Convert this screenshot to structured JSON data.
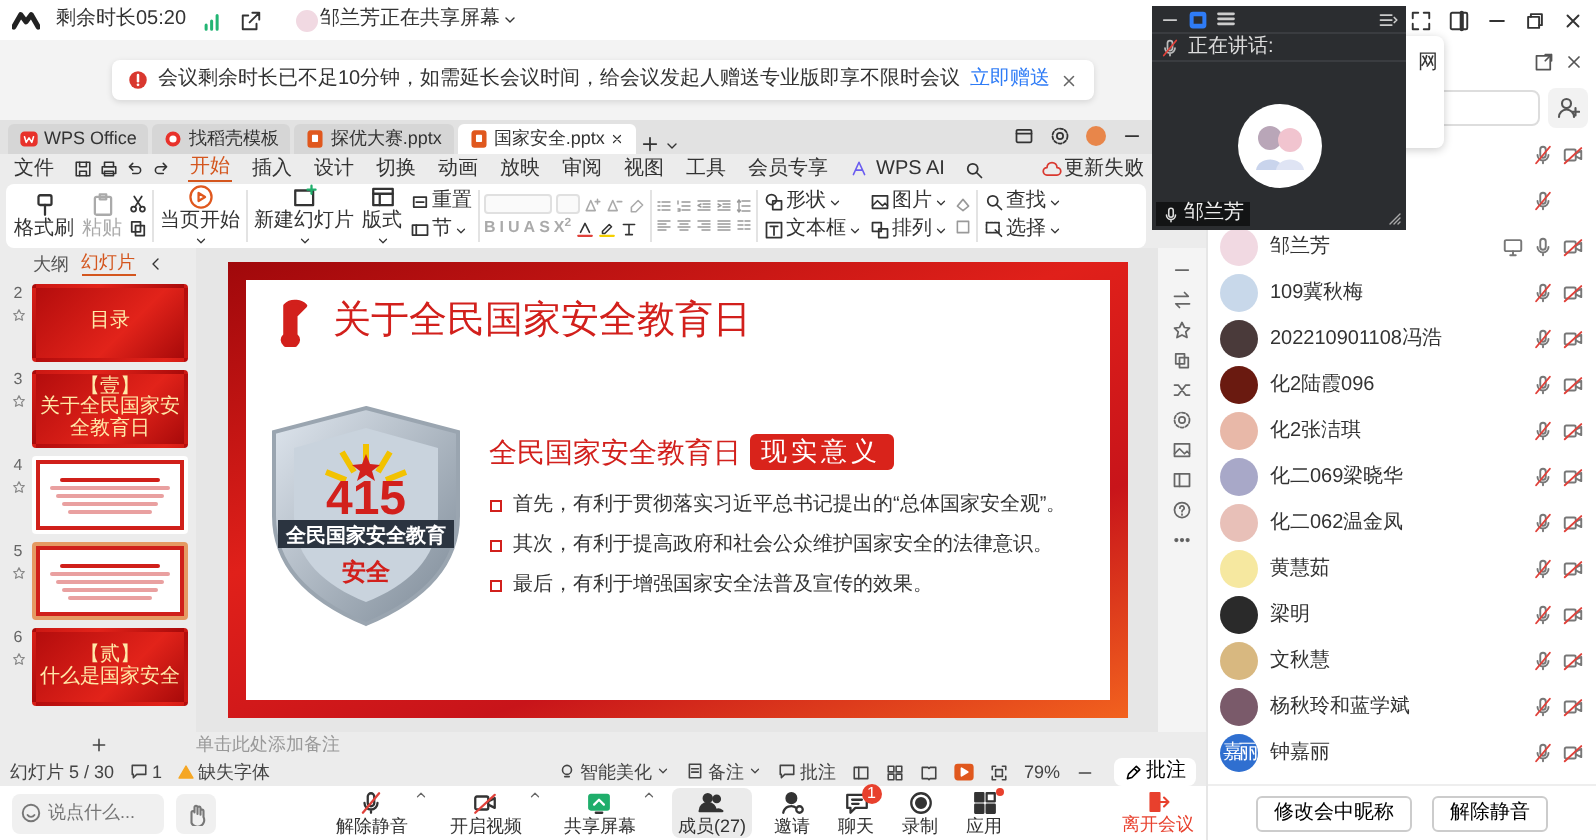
{
  "meeting_bar": {
    "remaining": "剩余时长05:20",
    "sharing": "邹兰芳正在共享屏幕"
  },
  "notice": {
    "text": "会议剩余时长已不足10分钟，如需延长会议时间，给会议发起人赠送专业版即享不限时会议",
    "link": "立即赠送"
  },
  "wps": {
    "tabs": [
      {
        "label": "WPS Office",
        "kind": "home",
        "selected": false
      },
      {
        "label": "找稻壳模板",
        "kind": "template",
        "selected": false
      },
      {
        "label": "探优大赛.pptx",
        "kind": "doc",
        "selected": false
      },
      {
        "label": "国家安全.pptx",
        "kind": "doc",
        "selected": true
      }
    ],
    "menu": [
      {
        "label": "文件",
        "selected": false
      },
      {
        "label": "开始",
        "selected": true
      },
      {
        "label": "插入",
        "selected": false
      },
      {
        "label": "设计",
        "selected": false
      },
      {
        "label": "切换",
        "selected": false
      },
      {
        "label": "动画",
        "selected": false
      },
      {
        "label": "放映",
        "selected": false
      },
      {
        "label": "审阅",
        "selected": false
      },
      {
        "label": "视图",
        "selected": false
      },
      {
        "label": "工具",
        "selected": false
      },
      {
        "label": "会员专享",
        "selected": false
      },
      {
        "label": "WPS AI",
        "selected": false
      }
    ],
    "update": "更新失败",
    "ribbon": {
      "format_painter": "格式刷",
      "paste": "粘贴",
      "start_here": "当页开始",
      "new_slide": "新建幻灯片",
      "layout": "版式",
      "reset": "重置",
      "section": "节",
      "font_buttons": [
        "B",
        "I",
        "U",
        "A",
        "S",
        "X$^{2}$"
      ],
      "shape": "形状",
      "picture": "图片",
      "textbox": "文本框",
      "arrange": "排列",
      "find": "查找",
      "select": "选择"
    },
    "panel_tabs": [
      {
        "label": "大纲",
        "selected": false
      },
      {
        "label": "幻灯片",
        "selected": true
      }
    ],
    "thumbnails": [
      {
        "number": "2",
        "kind": "title",
        "selected": false,
        "texts": [
          "目录"
        ]
      },
      {
        "number": "3",
        "kind": "title",
        "selected": false,
        "texts": [
          "【壹】",
          "关于全民国家安全教育日"
        ]
      },
      {
        "number": "4",
        "kind": "content",
        "selected": false
      },
      {
        "number": "5",
        "kind": "content",
        "selected": true
      },
      {
        "number": "6",
        "kind": "title",
        "selected": false,
        "texts": [
          "【贰】",
          "什么是国家安全"
        ]
      }
    ],
    "slide": {
      "title": "关于全民国家安全教育日",
      "shield_number": "415",
      "shield_band": "全民国家安全教育",
      "shield_word": "安全",
      "heading": "全民国家安全教育日",
      "heading_badge": "现实意义",
      "bullets": [
        "首先，有利于贯彻落实习近平总书记提出的“总体国家安全观”。",
        "其次，有利于提高政府和社会公众维护国家安全的法律意识。",
        "最后，有利于增强国家安全法普及宣传的效果。"
      ]
    },
    "notes_placeholder": "单击此处添加备注",
    "status": {
      "slide_count": "幻灯片 5 / 30",
      "comments_count": "1",
      "missing_font": "缺失字体",
      "beautify": "智能美化",
      "notes": "备注",
      "comments": "批注",
      "zoom": "79%",
      "comment_button": "批注"
    }
  },
  "toolbar": {
    "chat_placeholder": "说点什么...",
    "buttons": [
      {
        "label": "解除静音",
        "kind": "mic",
        "caret": true,
        "selected": false,
        "dot": false
      },
      {
        "label": "开启视频",
        "kind": "camera",
        "caret": true,
        "selected": false,
        "dot": false
      },
      {
        "label": "共享屏幕",
        "kind": "share",
        "caret": true,
        "selected": false,
        "dot": false
      },
      {
        "label": "成员(27)",
        "kind": "members",
        "caret": false,
        "selected": true,
        "dot": false
      },
      {
        "label": "邀请",
        "kind": "invite",
        "caret": false,
        "selected": false,
        "dot": false
      },
      {
        "label": "聊天",
        "kind": "chat",
        "caret": false,
        "selected": false,
        "dot": false,
        "badge": "1"
      },
      {
        "label": "录制",
        "kind": "record",
        "caret": false,
        "selected": false,
        "dot": false
      },
      {
        "label": "应用",
        "kind": "apps",
        "caret": false,
        "selected": false,
        "dot": true
      }
    ],
    "leave": "离开会议"
  },
  "video_window": {
    "speaking_label": "正在讲话:",
    "name": "邹兰芳"
  },
  "popup": {
    "text": "网"
  },
  "members": [
    {
      "muted": true,
      "camera_off": true,
      "sharing": false
    },
    {
      "muted": true,
      "camera_off": false,
      "sharing": false
    },
    {
      "name": "邹兰芳",
      "color": "#f1d9e2",
      "muted": false,
      "camera_off": true,
      "sharing": true
    },
    {
      "name": "109冀秋梅",
      "color": "#c8d8ea",
      "muted": true,
      "camera_off": true,
      "sharing": false
    },
    {
      "name": "202210901108冯浩",
      "color": "#4a3a3a",
      "muted": true,
      "camera_off": true,
      "sharing": false
    },
    {
      "name": "化2陆霞096",
      "color": "#6a1a10",
      "muted": true,
      "camera_off": true,
      "sharing": false
    },
    {
      "name": "化2张洁琪",
      "color": "#e8b8a8",
      "muted": true,
      "camera_off": true,
      "sharing": false
    },
    {
      "name": "化二069梁晓华",
      "color": "#a8a8c8",
      "muted": true,
      "camera_off": true,
      "sharing": false
    },
    {
      "name": "化二062温金凤",
      "color": "#e8c0b8",
      "muted": true,
      "camera_off": true,
      "sharing": false
    },
    {
      "name": "黄慧茹",
      "color": "#f6e8a0",
      "muted": true,
      "camera_off": true,
      "sharing": false
    },
    {
      "name": "梁明",
      "color": "#2a2a2a",
      "muted": true,
      "camera_off": true,
      "sharing": false
    },
    {
      "name": "文秋慧",
      "color": "#d8b880",
      "muted": true,
      "camera_off": true,
      "sharing": false
    },
    {
      "name": "杨秋玲和蓝学斌",
      "color": "#7a5a6a",
      "muted": true,
      "camera_off": true,
      "sharing": false
    },
    {
      "name": "钟嘉丽",
      "color": "#2f6fd0",
      "muted": true,
      "camera_off": true,
      "sharing": false,
      "avatar_text": "嘉丽"
    }
  ],
  "member_actions": [
    "修改会中昵称",
    "解除静音"
  ]
}
